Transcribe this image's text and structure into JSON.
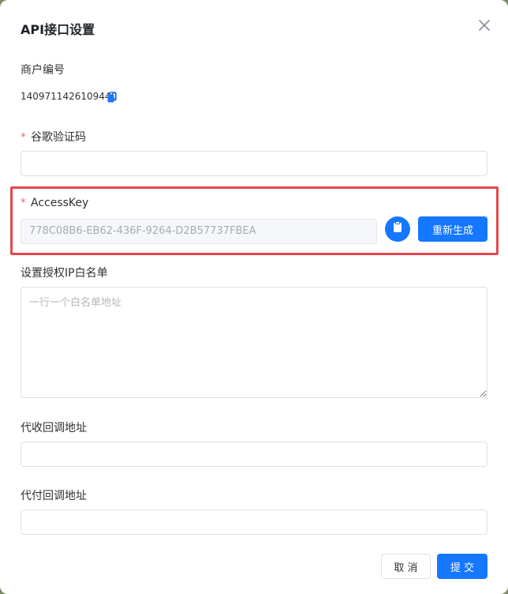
{
  "dialog": {
    "title": "API接口设置"
  },
  "merchant": {
    "label": "商户编号",
    "value": "1409711426109440"
  },
  "google_code": {
    "required_mark": "*",
    "label": "谷歌验证码",
    "value": ""
  },
  "access_key": {
    "required_mark": "*",
    "label": "AccessKey",
    "value": "778C08B6-EB62-436F-9264-D2B57737FBEA",
    "regenerate_label": "重新生成"
  },
  "ip_whitelist": {
    "label": "设置授权IP白名单",
    "placeholder": "一行一个白名单地址"
  },
  "collect_callback": {
    "label": "代收回调地址",
    "value": ""
  },
  "pay_callback": {
    "label": "代付回调地址",
    "value": ""
  },
  "footer": {
    "cancel_label": "取 消",
    "submit_label": "提 交"
  },
  "colors": {
    "primary": "#1677ff",
    "required": "#f56c6c",
    "highlight": "#e5484d"
  },
  "icons": {
    "close": "close-icon",
    "copy": "copy-icon",
    "copy_button": "copy-icon"
  }
}
